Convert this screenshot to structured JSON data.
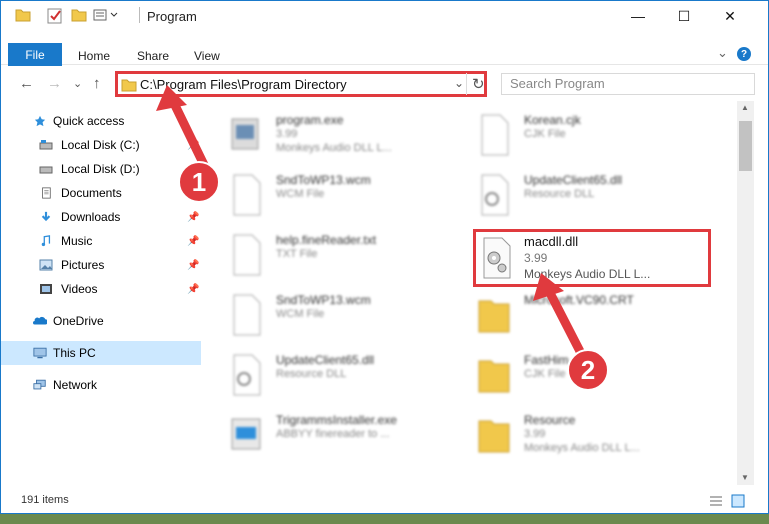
{
  "window": {
    "title": "Program",
    "min_glyph": "—",
    "max_glyph": "☐",
    "close_glyph": "✕"
  },
  "ribbon": {
    "tabs": [
      "File",
      "Home",
      "Share",
      "View"
    ],
    "collapse_glyph": "⌄",
    "help_glyph": "?"
  },
  "nav": {
    "back": "←",
    "forward": "→",
    "dropdown": "⌄",
    "up": "↑",
    "address": "C:\\Program Files\\Program Directory",
    "address_dropdown": "⌄",
    "refresh": "↻",
    "search_placeholder": "Search Program"
  },
  "sidebar": {
    "items": [
      {
        "label": "Quick access",
        "icon": "star-icon",
        "pinned": false
      },
      {
        "label": "Local Disk (C:)",
        "icon": "drive-icon",
        "pinned": true
      },
      {
        "label": "Local Disk (D:)",
        "icon": "drive-icon",
        "pinned": false
      },
      {
        "label": "Documents",
        "icon": "documents-icon",
        "pinned": true
      },
      {
        "label": "Downloads",
        "icon": "downloads-icon",
        "pinned": true
      },
      {
        "label": "Music",
        "icon": "music-icon",
        "pinned": true
      },
      {
        "label": "Pictures",
        "icon": "pictures-icon",
        "pinned": true
      },
      {
        "label": "Videos",
        "icon": "videos-icon",
        "pinned": true
      },
      {
        "label": "OneDrive",
        "icon": "onedrive-icon",
        "pinned": false
      },
      {
        "label": "This PC",
        "icon": "pc-icon",
        "pinned": false,
        "selected": true
      },
      {
        "label": "Network",
        "icon": "network-icon",
        "pinned": false
      }
    ]
  },
  "files": [
    {
      "name": "program.exe",
      "line1": "3.99",
      "line2": "Monkeys Audio DLL L..."
    },
    {
      "name": "Korean.cjk",
      "line1": "CJK File",
      "line2": ""
    },
    {
      "name": "SndToWP13.wcm",
      "line1": "WCM File",
      "line2": ""
    },
    {
      "name": "UpdateClient65.dll",
      "line1": "Resource DLL",
      "line2": ""
    },
    {
      "name": "help.fineReader.txt",
      "line1": "TXT File",
      "line2": ""
    },
    {
      "name": "SndToWP13.wcm",
      "line1": "WCM File",
      "line2": ""
    },
    {
      "name": "Microsoft.VC90.CRT",
      "line1": "",
      "line2": ""
    },
    {
      "name": "UpdateClient65.dll",
      "line1": "Resource DLL",
      "line2": ""
    },
    {
      "name": "FastHim",
      "line1": "CJK File",
      "line2": ""
    },
    {
      "name": "TrigrammsInstaller.exe",
      "line1": "ABBYY finereader to ...",
      "line2": ""
    },
    {
      "name": "Resource",
      "line1": "3.99",
      "line2": "Monkeys Audio DLL L..."
    }
  ],
  "highlighted_file": {
    "name": "macdll.dll",
    "line1": "3.99",
    "line2": "Monkeys Audio DLL L..."
  },
  "status": {
    "items_count": "191 items"
  },
  "annotations": {
    "step1": "1",
    "step2": "2"
  },
  "colors": {
    "accent": "#1979ca",
    "highlight_red": "#e03a3e"
  }
}
